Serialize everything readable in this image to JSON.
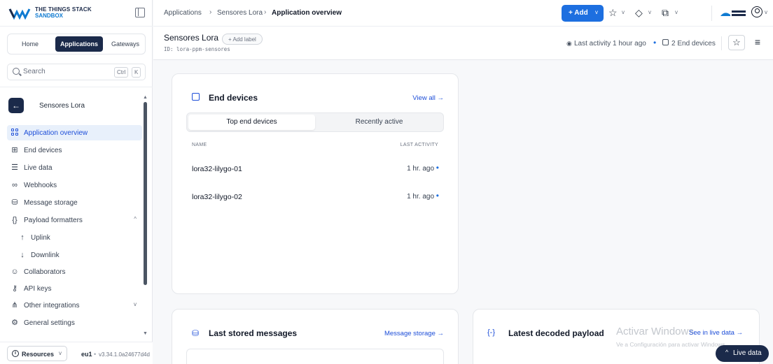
{
  "logo": {
    "line1": "THE THINGS STACK",
    "line2": "SANDBOX"
  },
  "top_tabs": [
    {
      "label": "Home"
    },
    {
      "label": "Applications",
      "active": true
    },
    {
      "label": "Gateways"
    }
  ],
  "search": {
    "placeholder": "Search",
    "kbd1": "Ctrl",
    "kbd2": "K"
  },
  "sidebar": {
    "app_name": "Sensores Lora",
    "items": [
      {
        "label": "Application overview",
        "icon": "grid-icon",
        "active": true
      },
      {
        "label": "End devices",
        "icon": "chip-icon"
      },
      {
        "label": "Live data",
        "icon": "list-icon"
      },
      {
        "label": "Webhooks",
        "icon": "webhook-icon"
      },
      {
        "label": "Message storage",
        "icon": "database-icon"
      },
      {
        "label": "Payload formatters",
        "icon": "code-icon",
        "expanded": true
      },
      {
        "label": "Uplink",
        "icon": "arrow-up-icon",
        "sub": true
      },
      {
        "label": "Downlink",
        "icon": "arrow-down-icon",
        "sub": true
      },
      {
        "label": "Collaborators",
        "icon": "users-icon"
      },
      {
        "label": "API keys",
        "icon": "key-icon"
      },
      {
        "label": "Other integrations",
        "icon": "integrations-icon",
        "collapsed": true
      },
      {
        "label": "General settings",
        "icon": "settings-icon"
      }
    ]
  },
  "footer": {
    "resources": "Resources",
    "cluster": "eu1",
    "version": "v3.34.1.0a24677d4d"
  },
  "breadcrumb": {
    "part1": "Applications",
    "part2": "Sensores Lora",
    "current": "Application overview"
  },
  "topbar": {
    "add_label": "+ Add"
  },
  "app": {
    "title": "Sensores Lora",
    "id": "ID: lora-ppm-sensores",
    "add_label": "+ Add label"
  },
  "status": {
    "last_activity": "Last activity 1 hour ago",
    "device_count": "2 End devices"
  },
  "end_devices_card": {
    "title": "End devices",
    "link": "View all →",
    "tabs": [
      "Top end devices",
      "Recently active"
    ],
    "col_name": "NAME",
    "col_activity": "LAST ACTIVITY",
    "rows": [
      {
        "name": "lora32-lilygo-01",
        "activity": "1 hr. ago"
      },
      {
        "name": "lora32-lilygo-02",
        "activity": "1 hr. ago"
      }
    ]
  },
  "stored_card": {
    "title": "Last stored messages",
    "link": "Message storage →"
  },
  "payload_card": {
    "title": "Latest decoded payload",
    "link": "See in live data →"
  },
  "watermark": {
    "line1": "Activar Windows",
    "line2": "Ve a Configuración para activar Windows."
  },
  "live_pill": {
    "label": "Live data"
  },
  "colors": {
    "primary": "#1d6fe0",
    "navy": "#1b2a4a",
    "active_bg": "#e8f0fb"
  }
}
